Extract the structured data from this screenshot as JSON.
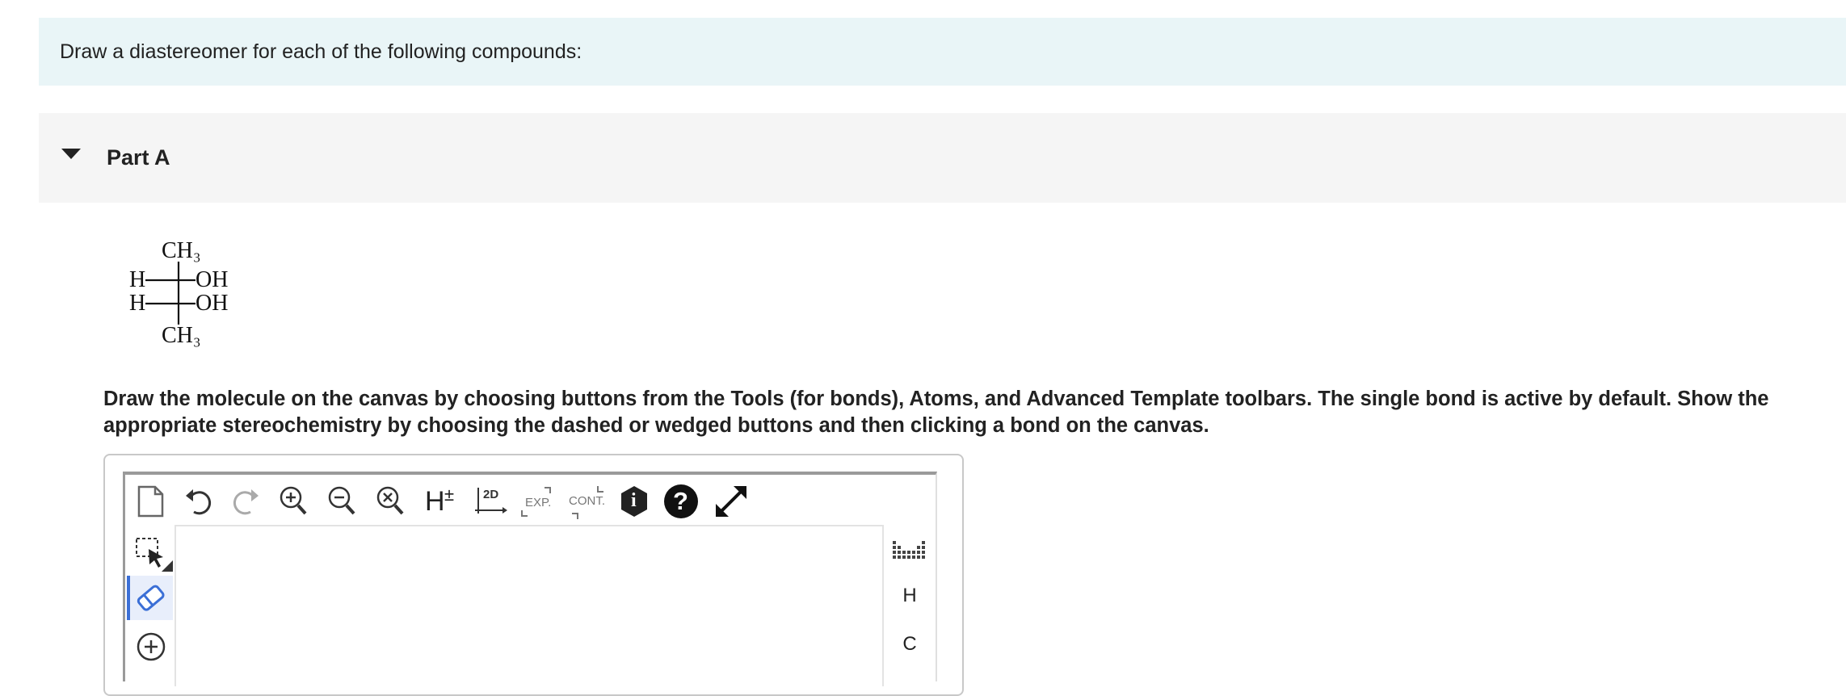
{
  "intro": {
    "text": "Draw a diastereomer for each of the following compounds:"
  },
  "part": {
    "title": "Part A"
  },
  "fischer": {
    "top": "CH3",
    "row1_left": "H",
    "row1_right": "OH",
    "row2_left": "H",
    "row2_right": "OH",
    "bottom": "CH3"
  },
  "instructions": "Draw the molecule on the canvas by choosing buttons from the Tools (for bonds), Atoms, and Advanced Template toolbars. The single bond is active by default. Show the appropriate stereochemistry by choosing the dashed or wedged buttons and then clicking a bond on the canvas.",
  "toolbar": {
    "h_label": "H",
    "h_pm": "±",
    "twod_label": "2D",
    "exp_label": "EXP.",
    "cont_label": "CONT.",
    "info_label": "i",
    "help_label": "?"
  },
  "atoms": {
    "h": "H",
    "c": "C"
  },
  "colors": {
    "accent": "#3b6fd6",
    "intro_bg": "#e9f5f7",
    "part_bg": "#f5f5f5"
  }
}
